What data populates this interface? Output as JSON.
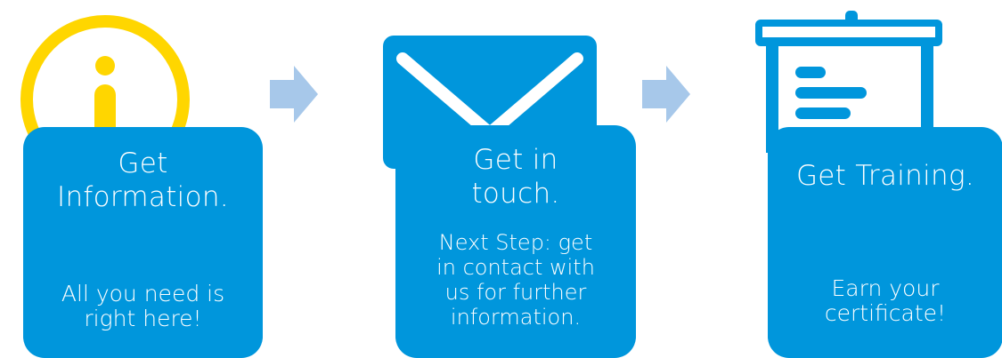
{
  "colors": {
    "card_blue": "#0096dc",
    "info_yellow": "#ffd600",
    "arrow_light_blue": "#a7c8ea",
    "text_white": "#ffffff"
  },
  "steps": [
    {
      "icon": "info-icon",
      "title": "Get\nInformation.",
      "description": "All you need is\nright here!"
    },
    {
      "icon": "envelope-icon",
      "title": "Get in\ntouch.",
      "description": "Next Step: get\nin contact with\nus for further\ninformation."
    },
    {
      "icon": "presentation-board-icon",
      "title": "Get Training.",
      "description": "Earn your\ncertificate!"
    }
  ],
  "connectors": [
    {
      "icon": "arrow-right-icon"
    },
    {
      "icon": "arrow-right-icon"
    }
  ]
}
